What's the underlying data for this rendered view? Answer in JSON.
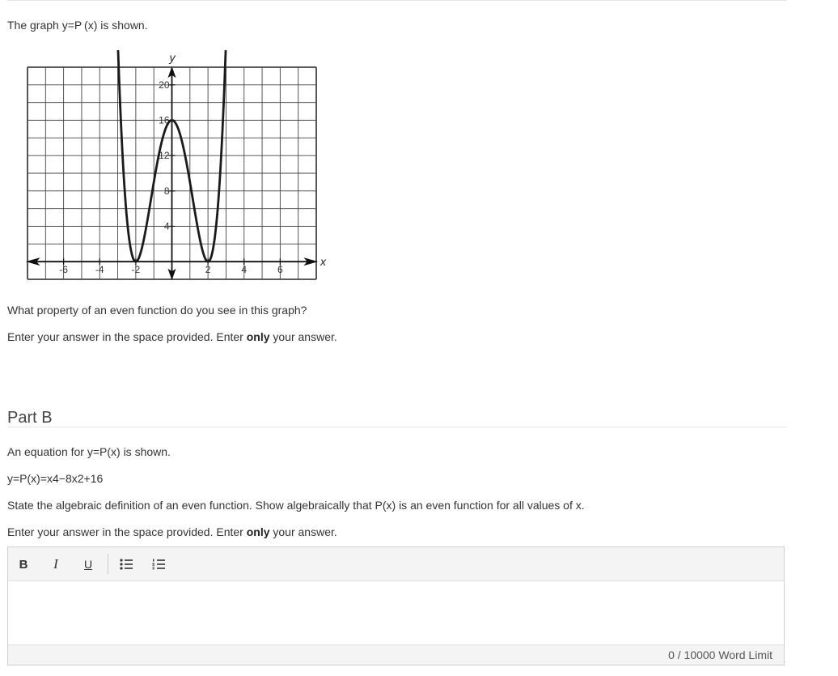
{
  "part_a": {
    "intro": "The graph y=P (x) is shown.",
    "question": "What property of an even function do you see in this graph?",
    "instruction_pre": "Enter your answer in the space provided. Enter ",
    "instruction_bold": "only",
    "instruction_post": " your answer."
  },
  "graph": {
    "axis_label_x": "x",
    "axis_label_y": "y",
    "x_ticks": [
      "-6",
      "-4",
      "-2",
      "2",
      "4",
      "6"
    ],
    "y_ticks": [
      "4",
      "8",
      "12",
      "16",
      "20"
    ]
  },
  "part_b": {
    "heading": "Part B",
    "intro": "An equation for y=P(x) is shown.",
    "equation": "y=P(x)=x4−8x2+16",
    "question": "State the algebraic definition of an even function. Show algebraically that P(x) is an even function for all values of x.",
    "instruction_pre": "Enter your answer in the space provided. Enter ",
    "instruction_bold": "only",
    "instruction_post": " your answer."
  },
  "editor": {
    "bold_label": "B",
    "italic_label": "I",
    "underline_label": "U",
    "word_count": "0",
    "word_limit_text": " / 10000 Word Limit"
  },
  "colors": {
    "curve": "#1a1a1a",
    "grid": "#444444",
    "toolbar_bg": "#f4f4f4"
  }
}
